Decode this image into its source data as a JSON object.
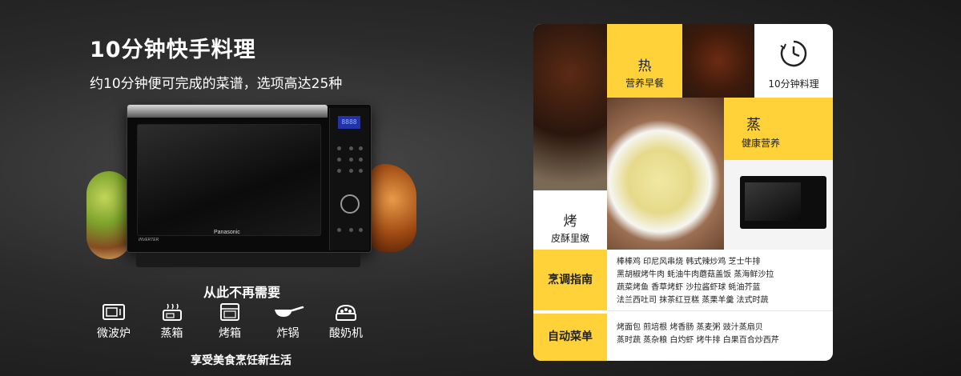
{
  "headline": "10分钟快手料理",
  "subline": "约10分钟便可完成的菜谱，选项高达25种",
  "oven": {
    "brand": "Panasonic",
    "badge": "INVERTER",
    "display": "8888"
  },
  "no_need_title": "从此不再需要",
  "appliances": [
    {
      "label": "微波炉",
      "icon": "microwave-icon"
    },
    {
      "label": "蒸箱",
      "icon": "steamer-icon"
    },
    {
      "label": "烤箱",
      "icon": "oven-icon"
    },
    {
      "label": "炸锅",
      "icon": "fryer-icon"
    },
    {
      "label": "酸奶机",
      "icon": "yogurt-maker-icon"
    }
  ],
  "footer": "享受美食烹饪新生活",
  "card": {
    "hot": {
      "char": "热",
      "caption": "营养早餐"
    },
    "clock": {
      "caption": "10分钟料理",
      "icon": "clock-icon"
    },
    "steam": {
      "char": "蒸",
      "caption": "健康营养"
    },
    "bake": {
      "char": "烤",
      "caption": "皮酥里嫩"
    },
    "guide": {
      "label": "烹调指南",
      "lines": [
        "棒棒鸡   印尼风串烧   韩式辣炒鸡   芝士牛排",
        "黑胡椒烤牛肉   蚝油牛肉蘑菇盖饭   蒸海鲜沙拉",
        "蔬菜烤鱼   香草烤虾   沙拉酱虾球   蚝油芥蓝",
        "法兰西吐司   抹茶红豆糕   蒸栗羊羹   法式时蔬"
      ]
    },
    "auto": {
      "label": "自动菜单",
      "lines": [
        "烤面包   煎培根   烤香肠   蒸麦粥   豉汁蒸扇贝",
        "蒸时蔬   蒸杂粮   白灼虾   烤牛排   白果百合炒西芹"
      ]
    }
  }
}
